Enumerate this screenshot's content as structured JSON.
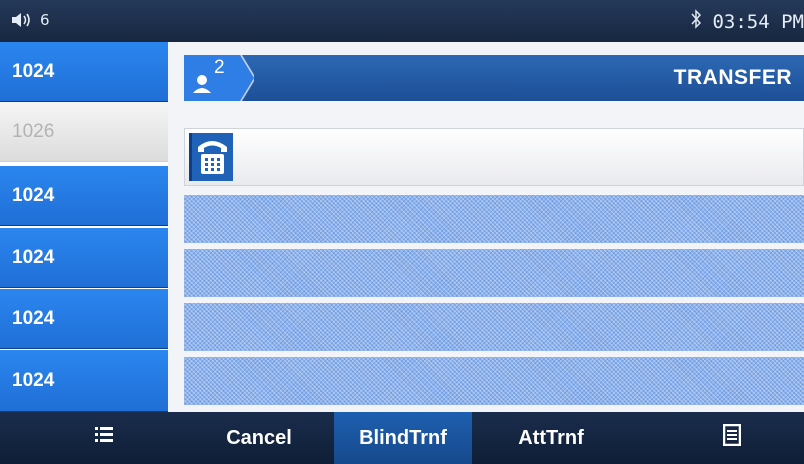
{
  "status_bar": {
    "volume_icon": "speaker-icon",
    "volume_level": "6",
    "bluetooth_icon": "bluetooth-icon",
    "time": "03:54 PM"
  },
  "lines": [
    {
      "label": "1024",
      "active": true
    },
    {
      "label": "1026",
      "active": false
    },
    {
      "label": "1024",
      "active": true
    },
    {
      "label": "1024",
      "active": true
    },
    {
      "label": "1024",
      "active": true
    },
    {
      "label": "1024",
      "active": true
    }
  ],
  "header": {
    "badge_icon": "conference-user-icon",
    "badge_count": "2",
    "title": "TRANSFER"
  },
  "input": {
    "icon": "phone-keypad-icon",
    "value": "",
    "placeholder": ""
  },
  "softkeys": {
    "menu_icon": "list-menu-icon",
    "cancel": "Cancel",
    "blind_transfer": "BlindTrnf",
    "attended_transfer": "AttTrnf",
    "more_icon": "more-options-icon"
  },
  "colors": {
    "accent": "#1f6fd6",
    "header": "#1d4f96",
    "status_bar": "#17273f"
  }
}
